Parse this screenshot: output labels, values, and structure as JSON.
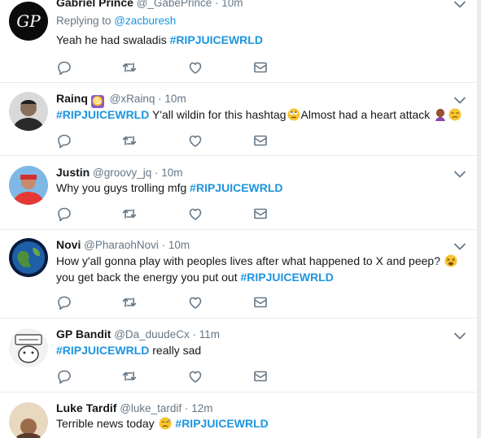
{
  "tweets": [
    {
      "name": "Gabriel Prince",
      "handle": "@_GabePrince",
      "sep": "·",
      "time": "10m",
      "replying_prefix": "Replying to ",
      "replying_to": "@zacburesh",
      "text_before": "Yeah he had swaladis ",
      "hashtag": "#RIPJUICEWRLD",
      "text_after": "",
      "avatar_text": "GP"
    },
    {
      "name": "Rainq",
      "badge": "♋",
      "handle": "@xRainq",
      "sep": "·",
      "time": "10m",
      "hashtag": "#RIPJUICEWRLD",
      "text_after": " Y'all wildin for this hashtag",
      "text_after2": "Almost had a heart attack",
      "emojis": [
        "eye-roll-emoji",
        "facepalm-emoji",
        "unamused-emoji"
      ]
    },
    {
      "name": "Justin",
      "handle": "@groovy_jq",
      "sep": "·",
      "time": "10m",
      "text_before": "Why you guys trolling mfg ",
      "hashtag": "#RIPJUICEWRLD"
    },
    {
      "name": "Novi",
      "handle": "@PharaohNovi",
      "sep": "·",
      "time": "10m",
      "line1": "How y'all gonna play with peoples lives after what happened to X and peep?",
      "line2_before": "you get back the energy you put out ",
      "hashtag": "#RIPJUICEWRLD",
      "emojis": [
        "tired-emoji"
      ]
    },
    {
      "name": "GP Bandit",
      "handle": "@Da_duudeCx",
      "sep": "·",
      "time": "11m",
      "hashtag": "#RIPJUICEWRLD",
      "text_after": " really sad"
    },
    {
      "name": "Luke Tardif",
      "handle": "@luke_tardif",
      "sep": "·",
      "time": "12m",
      "text_before": "Terrible news today ",
      "hashtag": "#RIPJUICEWRLD",
      "emojis": [
        "sad-sweat-emoji"
      ]
    }
  ],
  "colors": {
    "link": "#1b95e0",
    "muted": "#657786",
    "divider": "#e6ecf0"
  },
  "icons": [
    "reply-icon",
    "retweet-icon",
    "like-icon",
    "message-icon",
    "chevron-down-icon"
  ]
}
